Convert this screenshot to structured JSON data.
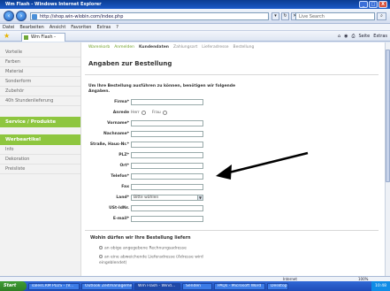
{
  "window": {
    "title": "Wm Flash - Windows Internet Explorer",
    "minimize": "_",
    "maximize": "□",
    "close": "X"
  },
  "address": {
    "url": "http://shop.win-wlobin.com/index.php",
    "search_placeholder": "Live Search"
  },
  "menu": [
    "Datei",
    "Bearbeiten",
    "Ansicht",
    "Favoriten",
    "Extras",
    "?"
  ],
  "tab": {
    "label": "Wm Flash -"
  },
  "commands": [
    "Seite",
    "Extras"
  ],
  "steps": [
    {
      "label": "Warenkorb",
      "state": "done"
    },
    {
      "label": "Anmelden",
      "state": "done"
    },
    {
      "label": "Kundendaten",
      "state": "current"
    },
    {
      "label": "Zahlungsart",
      "state": "todo"
    },
    {
      "label": "Lieferadresse",
      "state": "todo"
    },
    {
      "label": "Bestellung",
      "state": "todo"
    }
  ],
  "sidebar": {
    "items_top": [
      "Vorteile",
      "Farben",
      "Material",
      "Sonderform",
      "Zubehör",
      "40h Stundenlieferung"
    ],
    "service_heading": "Service / Produkte",
    "werbe_heading": "Werbeartikel",
    "items_bottom": [
      "Info",
      "Dekoration",
      "Preisliste"
    ]
  },
  "main": {
    "title": "Angaben zur Bestellung",
    "intro": "Um Ihre Bestellung ausführen zu können, benötigen wir folgende Angaben.",
    "fields": {
      "firma": "Firma*",
      "anrede": "Anrede",
      "herr": "Herr",
      "frau": "Frau",
      "vorname": "Vorname*",
      "nachname": "Nachname*",
      "strasse": "Straße, Haus-Nr.*",
      "plz": "PLZ*",
      "ort": "Ort*",
      "telefon": "Telefon*",
      "fax": "Fax",
      "land": "Land*",
      "land_value": "Bitte wählen",
      "ustid": "USt-IdNr.",
      "email": "E-mail*"
    },
    "delivery_title": "Wohin dürfen wir Ihre Bestellung liefern",
    "delivery_options": [
      "an obige angegebene Rechnungsadresse",
      "an eine abweichende Lieferadresse (Adresse wird eingeblendet)"
    ]
  },
  "status": {
    "zone": "Internet",
    "zoom": "100%"
  },
  "taskbar": {
    "start": "Start",
    "buttons": [
      "salesCRM PLUS - (V...",
      "Outlook Zeitmanagement...",
      "Wm Flash - Wind...",
      "Senden",
      "PAQs - Microsoft Word",
      "Desktop"
    ],
    "clock": "10:48"
  },
  "colors": {
    "accent_green": "#8ec63f",
    "title_blue": "#0b3d91"
  }
}
